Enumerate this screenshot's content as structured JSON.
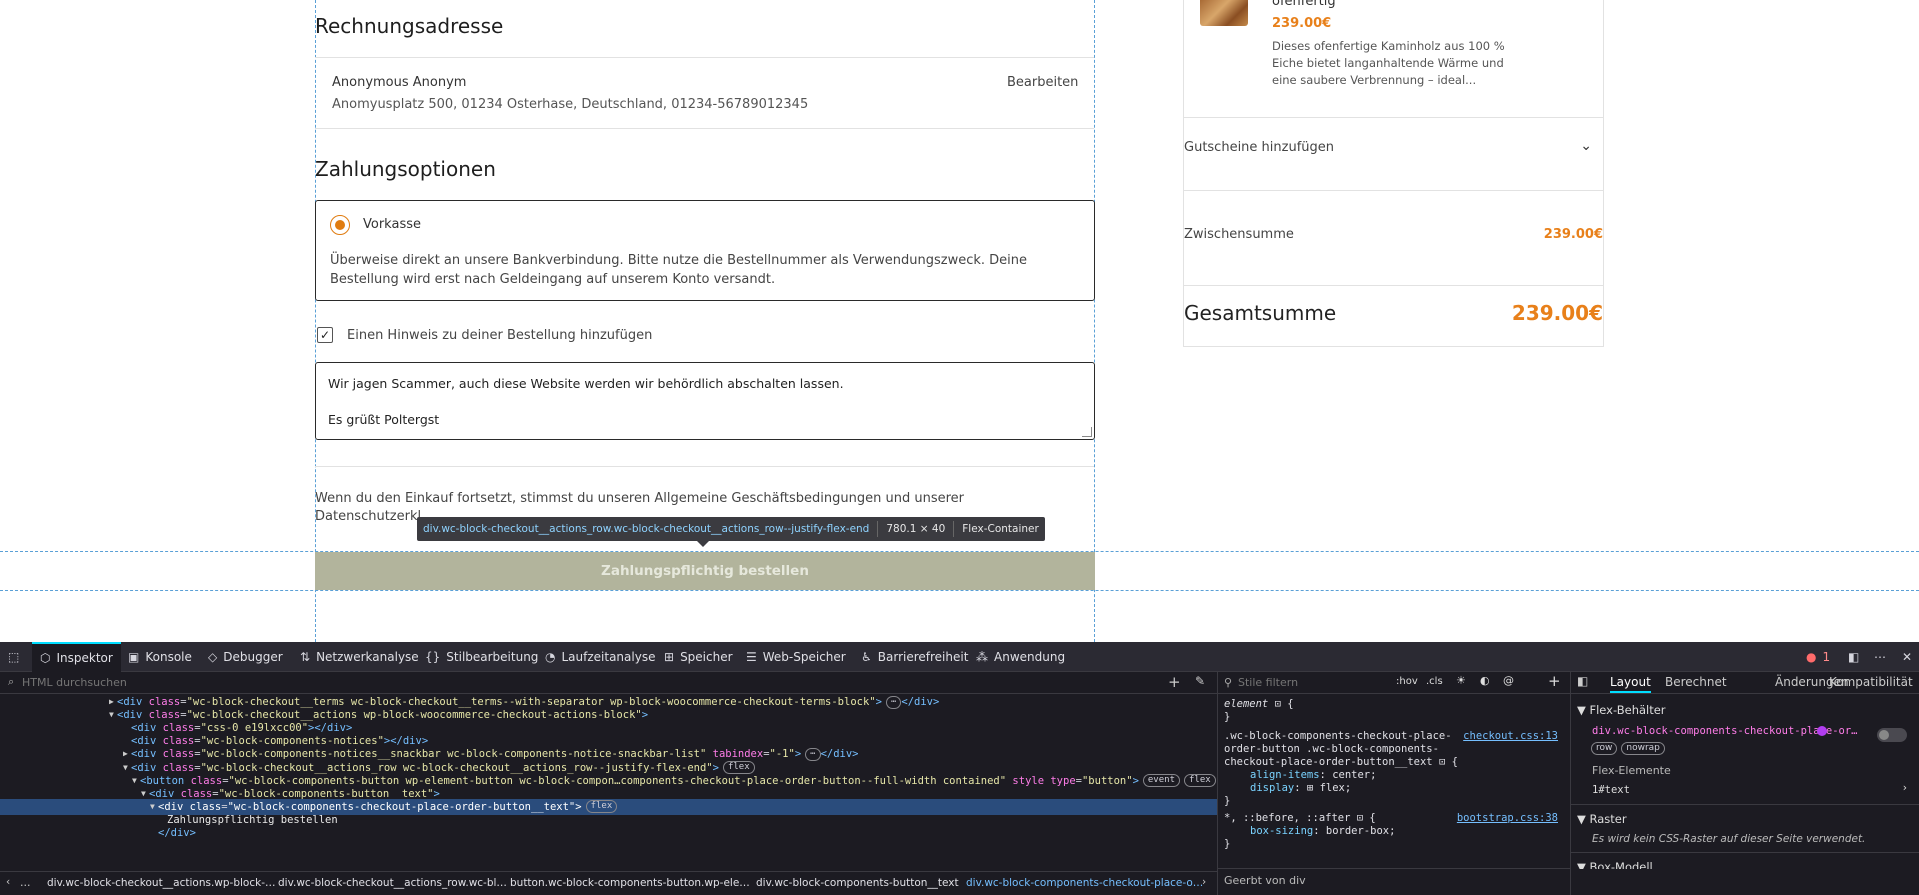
{
  "page": {
    "billing_title": "Rechnungsadresse",
    "address_name": "Anonymous Anonym",
    "address_line": "Anomyusplatz 500, 01234 Osterhase, Deutschland, 01234-56789012345",
    "edit_link": "Bearbeiten",
    "payment_title": "Zahlungsoptionen",
    "payment_option": "Vorkasse",
    "payment_desc_1": "Überweise direkt an unsere Bankverbindung. Bitte nutze die Bestellnummer als Verwendungszweck. Deine",
    "payment_desc_2": "Bestellung wird erst nach Geldeingang auf unserem Konto versandt.",
    "note_checkbox_label": "Einen Hinweis zu deiner Bestellung hinzufügen",
    "note_text_1": "Wir jagen Scammer, auch diese Website werden wir behördlich abschalten lassen.",
    "note_text_2": "Es grüßt Poltergst",
    "terms_1": "Wenn du den Einkauf fortsetzt, stimmst du unseren Allgemeine Geschäftsbedingungen und unserer",
    "terms_2": "Datenschutzerkl",
    "place_order": "Zahlungspflichtig bestellen"
  },
  "tooltip": {
    "selector": "div.wc-block-checkout__actions_row.wc-block-checkout__actions_row--justify-flex-end",
    "size": "780.1 × 40",
    "type": "Flex-Container"
  },
  "summary": {
    "product_name_partial": "ofenfertig",
    "product_price": "239.00€",
    "product_desc_1": "Dieses ofenfertige Kaminholz aus 100 %",
    "product_desc_2": "Eiche bietet langanhaltende Wärme und",
    "product_desc_3": "eine saubere Verbrennung – ideal...",
    "coupon": "Gutscheine hinzufügen",
    "subtotal_label": "Zwischensumme",
    "subtotal_value": "239.00€",
    "total_label": "Gesamtsumme",
    "total_value": "239.00€"
  },
  "devtools": {
    "tabs": [
      "Inspektor",
      "Konsole",
      "Debugger",
      "Netzwerkanalyse",
      "Stilbearbeitung",
      "Laufzeitanalyse",
      "Speicher",
      "Web-Speicher",
      "Barrierefreiheit",
      "Anwendung"
    ],
    "error_count": "1",
    "search_placeholder": "HTML durchsuchen",
    "styles_filter": "Stile filtern",
    "hov": ":hov",
    "cls": ".cls",
    "right_tabs": [
      "Layout",
      "Berechnet",
      "Änderungen",
      "Kompatibilität"
    ],
    "flex_behavior": "Flex-Behälter",
    "flex_selector": "div.wc-block-components-checkout-place-or…",
    "flex_badges": [
      "row",
      "nowrap"
    ],
    "flex_items": "Flex-Elemente",
    "flex_item_1": "1#text",
    "grid_title": "Raster",
    "grid_text": "Es wird kein CSS-Raster auf dieser Seite verwendet.",
    "box_model": "Box-Modell",
    "inherited": "Geerbt von div",
    "css_rule1_sel": "element",
    "css_rule2_sel_1": ".wc-block-components-checkout-place-",
    "css_rule2_sel_2": "order-button .wc-block-components-",
    "css_rule2_sel_3": "checkout-place-order-button__text",
    "css_rule2_src": "checkout.css:13",
    "css_rule2_p1": "align-items",
    "css_rule2_v1": "center;",
    "css_rule2_p2": "display",
    "css_rule2_v2": "flex;",
    "css_rule3_sel": "*, ::before, ::after",
    "css_rule3_src": "bootstrap.css:38",
    "css_rule3_p1": "box-sizing",
    "css_rule3_v1": "border-box;",
    "breadcrumbs": [
      "div.wc-block-checkout__actions.wp-block-…",
      "div.wc-block-checkout__actions_row.wc-bl…",
      "button.wc-block-components-button.wp-ele…",
      "div.wc-block-components-button__text",
      "div.wc-block-components-checkout-place-o…"
    ],
    "html_lines": [
      {
        "indent": 117,
        "arrow": "▶",
        "html": "<span class='tag'>&lt;div</span> <span class='attr'>class</span>=<span class='val'>\"wc-block-checkout__terms wc-block-checkout__terms--with-separator wp-block-woocommerce-checkout-terms-block\"</span><span class='tag'>&gt;</span><span class='badge'>⋯</span><span class='tag'>&lt;/div&gt;</span>"
      },
      {
        "indent": 117,
        "arrow": "▼",
        "html": "<span class='tag'>&lt;div</span> <span class='attr'>class</span>=<span class='val'>\"wc-block-checkout__actions wp-block-woocommerce-checkout-actions-block\"</span><span class='tag'>&gt;</span>"
      },
      {
        "indent": 131,
        "arrow": "",
        "html": "<span class='tag'>&lt;div</span> <span class='attr'>class</span>=<span class='val'>\"css-0 e19lxcc00\"</span><span class='tag'>&gt;&lt;/div&gt;</span>"
      },
      {
        "indent": 131,
        "arrow": "",
        "html": "<span class='tag'>&lt;div</span> <span class='attr'>class</span>=<span class='val'>\"wc-block-components-notices\"</span><span class='tag'>&gt;&lt;/div&gt;</span>"
      },
      {
        "indent": 131,
        "arrow": "▶",
        "html": "<span class='tag'>&lt;div</span> <span class='attr'>class</span>=<span class='val'>\"wc-block-components-notices__snackbar wc-block-components-notice-snackbar-list\"</span> <span class='attr'>tabindex</span>=<span class='val'>\"-1\"</span><span class='tag'>&gt;</span><span class='badge'>⋯</span><span class='tag'>&lt;/div&gt;</span>"
      },
      {
        "indent": 131,
        "arrow": "▼",
        "html": "<span class='tag'>&lt;div</span> <span class='attr'>class</span>=<span class='val'>\"wc-block-checkout__actions_row wc-block-checkout__actions_row--justify-flex-end\"</span><span class='tag'>&gt;</span><span class='badge'>flex</span>"
      },
      {
        "indent": 140,
        "arrow": "▼",
        "html": "<span class='tag'>&lt;button</span> <span class='attr'>class</span>=<span class='val'>\"wc-block-components-button wp-element-button wc-block-compon…components-checkout-place-order-button--full-width contained\"</span> <span class='attr'>style</span> <span class='attr'>type</span>=<span class='val'>\"button\"</span><span class='tag'>&gt;</span><span class='badge'>event</span><span class='badge'>flex</span>"
      },
      {
        "indent": 149,
        "arrow": "▼",
        "html": "<span class='tag'>&lt;div</span> <span class='attr'>class</span>=<span class='val'>\"wc-block-components-button__text\"</span><span class='tag'>&gt;</span>"
      },
      {
        "indent": 158,
        "arrow": "▼",
        "sel": true,
        "html": "<span class='tag' style='color:#fff'>&lt;div</span> <span class='attr' style='color:#fff'>class</span>=<span class='val' style='color:#fff'>\"wc-block-components-checkout-place-order-button__text\"</span><span class='tag' style='color:#fff'>&gt;</span><span class='badge'>flex</span>"
      },
      {
        "indent": 167,
        "arrow": "",
        "html": "<span class='txt'>Zahlungspflichtig bestellen</span>"
      },
      {
        "indent": 158,
        "arrow": "",
        "html": "<span class='tag'>&lt;/div&gt;</span>"
      }
    ]
  }
}
